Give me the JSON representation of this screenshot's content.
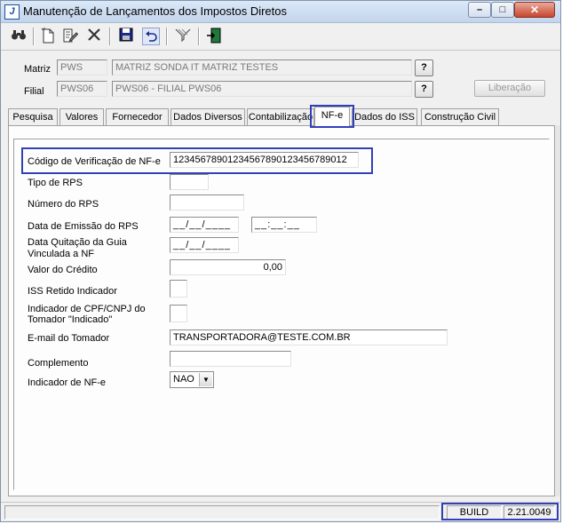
{
  "window": {
    "title": "Manutenção de Lançamentos dos Impostos Diretos",
    "app_icon_letter": "J",
    "minimize": "–",
    "maximize": "□",
    "close": "✕"
  },
  "toolbar": {
    "icons": [
      "binoculars-icon",
      "new-document-icon",
      "edit-icon",
      "delete-icon",
      "save-icon",
      "undo-icon",
      "filter-icon",
      "exit-door-icon"
    ]
  },
  "header": {
    "matriz_label": "Matriz",
    "matriz_code": "PWS",
    "matriz_name": "MATRIZ SONDA IT MATRIZ TESTES",
    "filial_label": "Filial",
    "filial_code": "PWS06",
    "filial_name": "PWS06 - FILIAL PWS06",
    "lookup_label": "?",
    "liberacao_label": "Liberação"
  },
  "tabs": [
    {
      "label": "Pesquisa"
    },
    {
      "label": "Valores"
    },
    {
      "label": "Fornecedor"
    },
    {
      "label": "Dados Diversos"
    },
    {
      "label": "Contabilização"
    },
    {
      "label": "NF-e"
    },
    {
      "label": "Dados do ISS"
    },
    {
      "label": "Construção Civil"
    }
  ],
  "form": {
    "codigo_label": "Código de Verificação de NF-e",
    "codigo_value": "123456789012345678901234567890​12",
    "tipo_rps_label": "Tipo de RPS",
    "tipo_rps_value": "",
    "numero_rps_label": "Número do RPS",
    "numero_rps_value": "",
    "data_emissao_label": "Data de Emissão do RPS",
    "data_emissao_date": "__/__/____",
    "data_emissao_time": "__:__:__",
    "data_quitacao_label1": "Data Quitação da Guia",
    "data_quitacao_label2": "Vinculada a NF",
    "data_quitacao_value": "__/__/____",
    "valor_credito_label": "Valor do Crédito",
    "valor_credito_value": "0,00",
    "iss_retido_label": "ISS Retido Indicador",
    "indicador_cpf_label1": "Indicador de CPF/CNPJ do",
    "indicador_cpf_label2": "Tomador \"Indicado\"",
    "email_label": "E-mail do Tomador",
    "email_value": "TRANSPORTADORA@TESTE.COM.BR",
    "complemento_label": "Complemento",
    "complemento_value": "",
    "indicador_nfe_label": "Indicador de NF-e",
    "indicador_nfe_value": "NAO"
  },
  "status": {
    "build_label": "BUILD",
    "build_version": "2.21.0049"
  },
  "colors": {
    "highlight": "#3240b8"
  }
}
